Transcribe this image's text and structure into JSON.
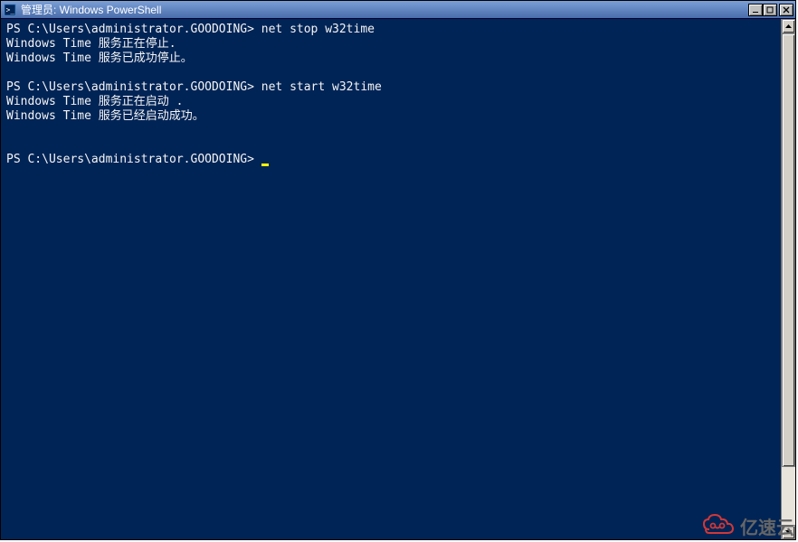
{
  "window": {
    "title": "管理员: Windows PowerShell"
  },
  "terminal": {
    "lines": [
      {
        "prompt": "PS C:\\Users\\administrator.GOODOING> ",
        "command": "net stop w32time"
      },
      {
        "text": "Windows Time 服务正在停止."
      },
      {
        "text": "Windows Time 服务已成功停止。"
      },
      {
        "text": ""
      },
      {
        "prompt": "PS C:\\Users\\administrator.GOODOING> ",
        "command": "net start w32time"
      },
      {
        "text": "Windows Time 服务正在启动 ."
      },
      {
        "text": "Windows Time 服务已经启动成功。"
      },
      {
        "text": ""
      },
      {
        "text": ""
      },
      {
        "prompt": "PS C:\\Users\\administrator.GOODOING> ",
        "cursor": true
      }
    ]
  },
  "watermark": {
    "text": "亿速云"
  }
}
